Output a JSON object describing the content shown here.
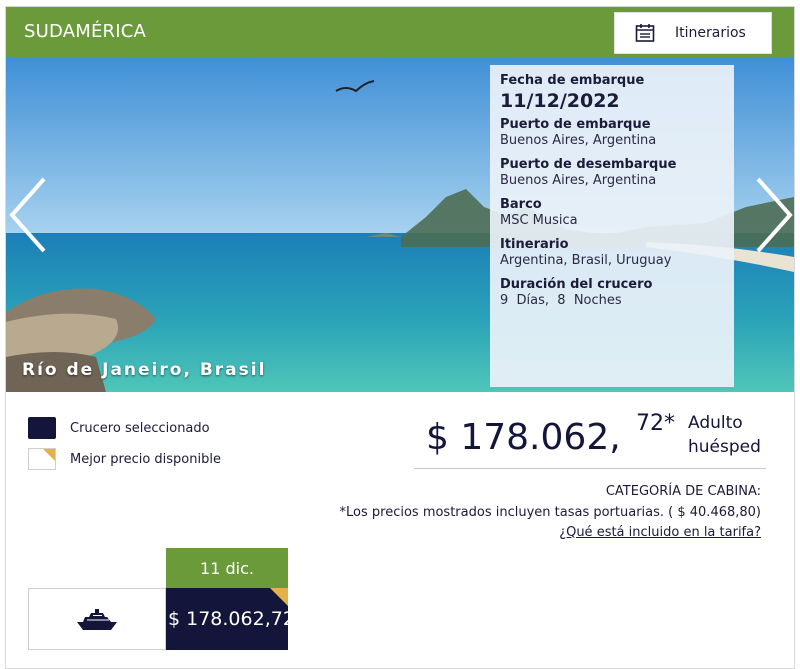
{
  "header": {
    "region": "SUDAMÉRICA",
    "itinerary_button": "Itinerarios"
  },
  "hero": {
    "location_caption": "Río de Janeiro, Brasil",
    "prev_icon": "chevron-left-icon",
    "next_icon": "chevron-right-icon"
  },
  "details": {
    "embark_date_label": "Fecha de embarque",
    "embark_date_value": "11/12/2022",
    "embark_port_label": "Puerto de embarque",
    "embark_port_value": "Buenos Aires, Argentina",
    "disembark_port_label": "Puerto de desembarque",
    "disembark_port_value": "Buenos Aires, Argentina",
    "ship_label": "Barco",
    "ship_value": "MSC Musica",
    "itinerary_label": "Itinerario",
    "itinerary_value": "Argentina, Brasil, Uruguay",
    "duration_label": "Duración del crucero",
    "duration_value": "9  Días,  8  Noches"
  },
  "legend": {
    "selected": "Crucero seleccionado",
    "best_price": "Mejor precio disponible"
  },
  "price": {
    "main": "$ 178.062,",
    "cents": "72*",
    "unit_line1": "Adulto",
    "unit_line2": "huésped",
    "cabin_category": "CATEGORÍA DE CABINA:",
    "tax_note": "*Los precios mostrados incluyen tasas portuarias. ( $ 40.468,80)",
    "fare_link": "¿Qué está incluido en la tarifa?"
  },
  "date_selector": {
    "date": "11 dic.",
    "price": "$ 178.062,72"
  },
  "colors": {
    "header_green": "#6b9a3b",
    "navy": "#13153a",
    "best_price_gold": "#e3b14a"
  }
}
